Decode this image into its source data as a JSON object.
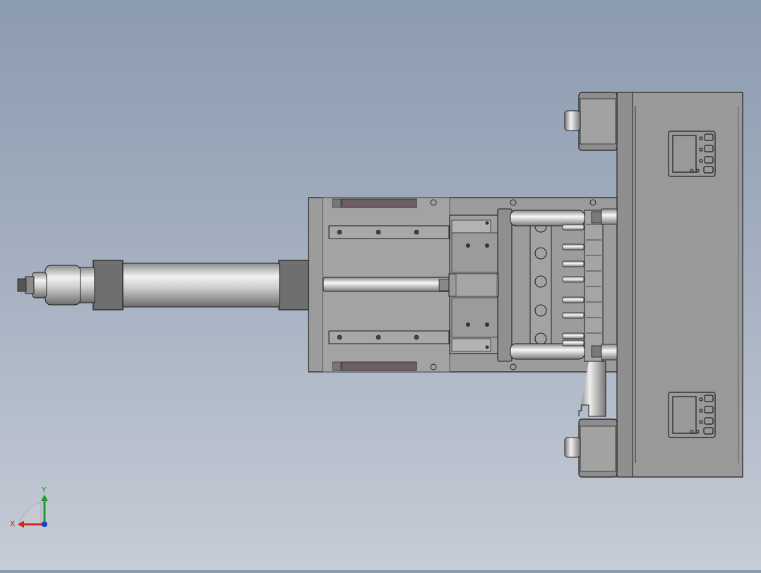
{
  "viewport": {
    "background_top": "#8b9bb0",
    "background_bottom": "#c7ccd6",
    "model_colors": {
      "body": "#9a9a9a",
      "dark": "#6a6a6a",
      "edge": "#1e1e1e",
      "rail_accent": "#6e5f66"
    }
  },
  "triad": {
    "x_label": "X",
    "y_label": "Y",
    "x_color": "#d0261f",
    "y_color": "#1f9a2c",
    "z_color": "#1a3fc8"
  }
}
